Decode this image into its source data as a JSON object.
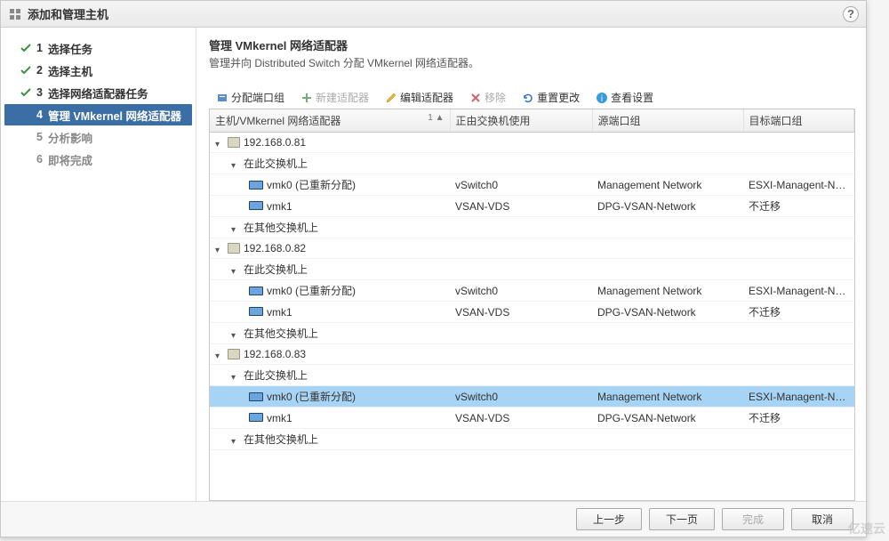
{
  "dialog": {
    "title": "添加和管理主机"
  },
  "steps": [
    {
      "num": "1",
      "label": "选择任务",
      "state": "done"
    },
    {
      "num": "2",
      "label": "选择主机",
      "state": "done"
    },
    {
      "num": "3",
      "label": "选择网络适配器任务",
      "state": "done"
    },
    {
      "num": "4",
      "label": "管理 VMkernel 网络适配器",
      "state": "current"
    },
    {
      "num": "5",
      "label": "分析影响",
      "state": "future"
    },
    {
      "num": "6",
      "label": "即将完成",
      "state": "future"
    }
  ],
  "section": {
    "title": "管理 VMkernel 网络适配器",
    "subtitle": "管理并向 Distributed Switch 分配 VMkernel 网络适配器。"
  },
  "toolbar": {
    "assign": "分配端口组",
    "new": "新建适配器",
    "edit": "编辑适配器",
    "remove": "移除",
    "reset": "重置更改",
    "view": "查看设置"
  },
  "columns": {
    "c0": "主机/VMkernel 网络适配器",
    "sort": "1 ▲",
    "c1": "正由交换机使用",
    "c2": "源端口组",
    "c3": "目标端口组"
  },
  "rows": [
    {
      "indent": 0,
      "type": "host",
      "label": "192.168.0.81",
      "c1": "",
      "c2": "",
      "c3": ""
    },
    {
      "indent": 1,
      "type": "group",
      "label": "在此交换机上",
      "c1": "",
      "c2": "",
      "c3": ""
    },
    {
      "indent": 2,
      "type": "vmk",
      "label": "vmk0 (已重新分配)",
      "c1": "vSwitch0",
      "c2": "Management Network",
      "c3": "ESXI-Managent-Network"
    },
    {
      "indent": 2,
      "type": "vmk",
      "label": "vmk1",
      "c1": "VSAN-VDS",
      "c2": "DPG-VSAN-Network",
      "c3": "不迁移"
    },
    {
      "indent": 1,
      "type": "group",
      "label": "在其他交换机上",
      "c1": "",
      "c2": "",
      "c3": ""
    },
    {
      "indent": 0,
      "type": "host",
      "label": "192.168.0.82",
      "c1": "",
      "c2": "",
      "c3": ""
    },
    {
      "indent": 1,
      "type": "group",
      "label": "在此交换机上",
      "c1": "",
      "c2": "",
      "c3": ""
    },
    {
      "indent": 2,
      "type": "vmk",
      "label": "vmk0 (已重新分配)",
      "c1": "vSwitch0",
      "c2": "Management Network",
      "c3": "ESXI-Managent-Network"
    },
    {
      "indent": 2,
      "type": "vmk",
      "label": "vmk1",
      "c1": "VSAN-VDS",
      "c2": "DPG-VSAN-Network",
      "c3": "不迁移"
    },
    {
      "indent": 1,
      "type": "group",
      "label": "在其他交换机上",
      "c1": "",
      "c2": "",
      "c3": ""
    },
    {
      "indent": 0,
      "type": "host",
      "label": "192.168.0.83",
      "c1": "",
      "c2": "",
      "c3": ""
    },
    {
      "indent": 1,
      "type": "group",
      "label": "在此交换机上",
      "c1": "",
      "c2": "",
      "c3": ""
    },
    {
      "indent": 2,
      "type": "vmk",
      "label": "vmk0 (已重新分配)",
      "c1": "vSwitch0",
      "c2": "Management Network",
      "c3": "ESXI-Managent-Network",
      "selected": true
    },
    {
      "indent": 2,
      "type": "vmk",
      "label": "vmk1",
      "c1": "VSAN-VDS",
      "c2": "DPG-VSAN-Network",
      "c3": "不迁移"
    },
    {
      "indent": 1,
      "type": "group",
      "label": "在其他交换机上",
      "c1": "",
      "c2": "",
      "c3": ""
    }
  ],
  "footer": {
    "prev": "上一步",
    "next": "下一页",
    "finish": "完成",
    "cancel": "取消"
  },
  "watermark": "亿速云"
}
